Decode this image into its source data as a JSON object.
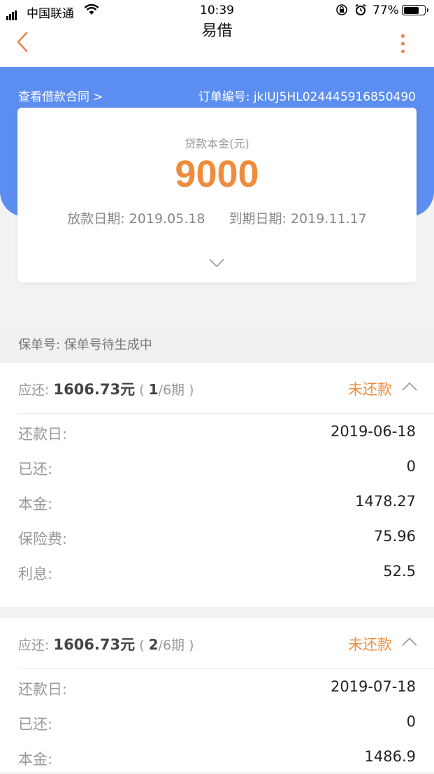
{
  "status_bar": {
    "carrier": "中国联通",
    "time": "10:39",
    "battery_pct": "77%",
    "battery_level": 0.77,
    "icons": [
      "signal-icon",
      "wifi-icon",
      "orientation-lock-icon",
      "alarm-icon",
      "battery-icon"
    ]
  },
  "nav": {
    "title": "易借",
    "back_icon": "chevron-left-icon",
    "more_icon": "more-vertical-icon"
  },
  "hero": {
    "contract_link": "查看借款合同 >",
    "order_no": "订单编号: jklUJ5HL024445916850490"
  },
  "loan": {
    "principal_label": "贷款本金(元)",
    "principal_value": "9000",
    "disbursed_date": "放款日期: 2019.05.18",
    "due_date": "到期日期: 2019.11.17"
  },
  "policy": {
    "text": "保单号: 保单号待生成中"
  },
  "installments": [
    {
      "due_label": "应还:",
      "amount": "1606.73元",
      "open": "(",
      "period": "1",
      "total": "/6期",
      "close": ")",
      "status": "未还款",
      "rows": [
        {
          "k": "还款日:",
          "v": "2019-06-18"
        },
        {
          "k": "已还:",
          "v": "0"
        },
        {
          "k": "本金:",
          "v": "1478.27"
        },
        {
          "k": "保险费:",
          "v": "75.96"
        },
        {
          "k": "利息:",
          "v": "52.5"
        }
      ]
    },
    {
      "due_label": "应还:",
      "amount": "1606.73元",
      "open": "(",
      "period": "2",
      "total": "/6期",
      "close": ")",
      "status": "未还款",
      "rows": [
        {
          "k": "还款日:",
          "v": "2019-07-18"
        },
        {
          "k": "已还:",
          "v": "0"
        },
        {
          "k": "本金:",
          "v": "1486.9"
        }
      ]
    }
  ],
  "colors": {
    "accent": "#ef8c3c",
    "hero_blue": "#5b8ef0"
  }
}
